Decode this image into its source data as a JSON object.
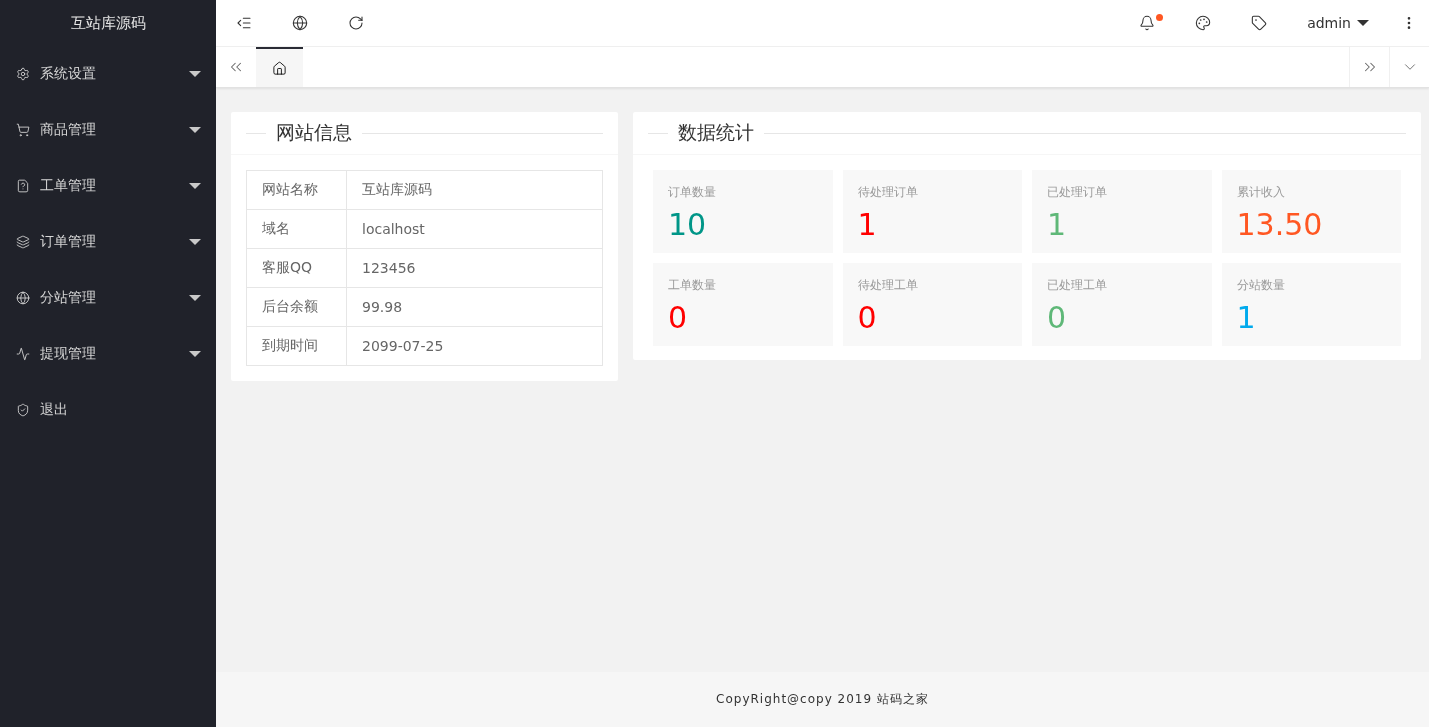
{
  "sidebar": {
    "logo": "互站库源码",
    "items": [
      {
        "label": "系统设置",
        "kind": "group"
      },
      {
        "label": "商品管理",
        "kind": "group"
      },
      {
        "label": "工单管理",
        "kind": "group"
      },
      {
        "label": "订单管理",
        "kind": "group"
      },
      {
        "label": "分站管理",
        "kind": "group"
      },
      {
        "label": "提现管理",
        "kind": "group"
      },
      {
        "label": "退出",
        "kind": "link"
      }
    ]
  },
  "header": {
    "notification_dot": true,
    "user": "admin"
  },
  "tabs": [
    {
      "selected": true
    }
  ],
  "site_info": {
    "title": "网站信息",
    "rows": [
      {
        "label": "网站名称",
        "value": "互站库源码"
      },
      {
        "label": "域名",
        "value": "localhost"
      },
      {
        "label": "客服QQ",
        "value": "123456"
      },
      {
        "label": "后台余额",
        "value": "99.98"
      },
      {
        "label": "到期时间",
        "value": "2099-07-25"
      }
    ]
  },
  "stats": {
    "title": "数据统计",
    "items": [
      {
        "label": "订单数量",
        "value": "10",
        "color": "#009688"
      },
      {
        "label": "待处理订单",
        "value": "1",
        "color": "#ff0000"
      },
      {
        "label": "已处理订单",
        "value": "1",
        "color": "#5fb878"
      },
      {
        "label": "累计收入",
        "value": "13.50",
        "color": "#ff5722"
      },
      {
        "label": "工单数量",
        "value": "0",
        "color": "#ff0000"
      },
      {
        "label": "待处理工单",
        "value": "0",
        "color": "#ff0000"
      },
      {
        "label": "已处理工单",
        "value": "0",
        "color": "#5fb878"
      },
      {
        "label": "分站数量",
        "value": "1",
        "color": "#01aaed"
      }
    ]
  },
  "footer": "CopyRight@copy 2019 站码之家"
}
